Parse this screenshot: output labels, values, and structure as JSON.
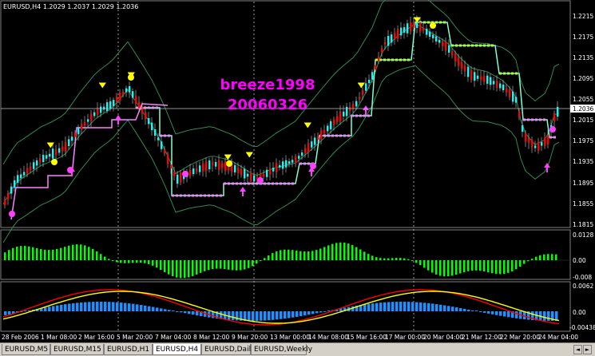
{
  "chart_header": "EURUSD,H4  1.2029 1.2037 1.2029 1.2036",
  "watermark": [
    "breeze1998",
    "20060326"
  ],
  "price_axis": [
    "1.2215",
    "1.2175",
    "1.2135",
    "1.2095",
    "1.2055",
    "1.2015",
    "1.1975",
    "1.1935",
    "1.1895",
    "1.1855",
    "1.1815"
  ],
  "current_price": "1.2036",
  "histogram_axis": [
    "0.0128",
    "0.00",
    "-0.008"
  ],
  "oscillator_axis": [
    "0.0062",
    "0.00",
    "-0.00438"
  ],
  "time_axis": [
    "28 Feb 2006",
    "1 Mar 08:00",
    "2 Mar 16:00",
    "5 Mar 20:00",
    "7 Mar 04:00",
    "8 Mar 12:00",
    "9 Mar 20:00",
    "13 Mar 00:00",
    "14 Mar 08:00",
    "15 Mar 16:00",
    "17 Mar 00:00",
    "20 Mar 04:00",
    "21 Mar 12:00",
    "22 Mar 20:00",
    "24 Mar 04:00"
  ],
  "tabs": [
    "EURUSD,M5",
    "EURUSD,M15",
    "EURUSD,H1",
    "EURUSD,H4",
    "EURUSD,Daily",
    "EURUSD,Weekly"
  ],
  "active_tab": "EURUSD,H4",
  "nav_buttons": [
    "◄",
    "►"
  ],
  "colors": {
    "grid": "#c0c0c0",
    "bull_candle": "#ff0000",
    "bear_candle": "#00ffff",
    "band": "#2e8b57",
    "up_line": "#ff80ff",
    "down_line": "#7fffd4",
    "buy_arrow": "#ff40ff",
    "sell_arrow": "#ffff00",
    "histogram_bar": "#00ff00",
    "osc_bar": "#1e90ff",
    "osc_red": "#ff0000",
    "osc_yellow": "#ffff00",
    "watermark": "#ff00ff"
  }
}
